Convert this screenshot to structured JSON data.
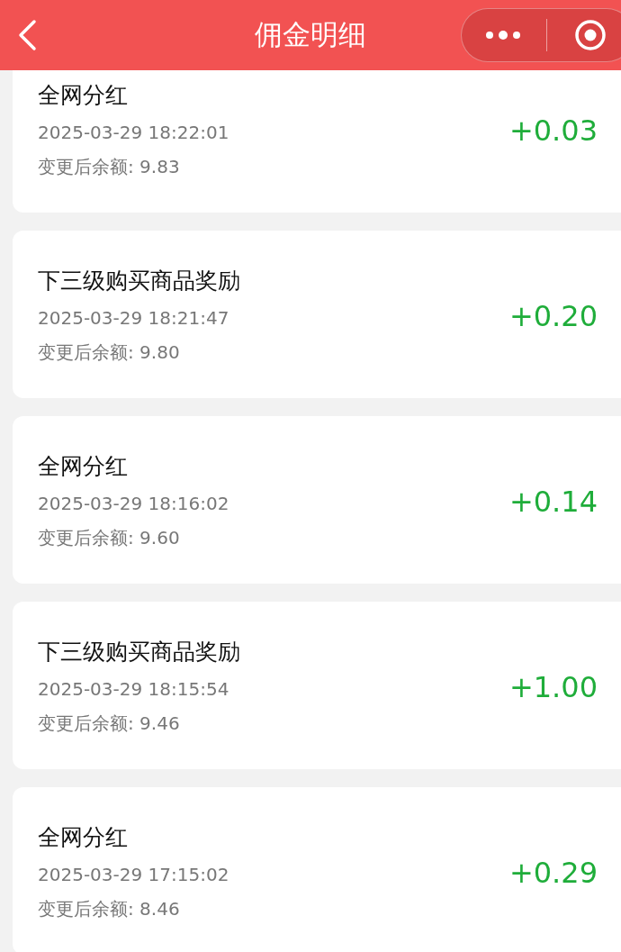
{
  "header": {
    "title": "佣金明细"
  },
  "records": [
    {
      "title": "全网分红",
      "time": "2025-03-29 18:22:01",
      "balance": "变更后余额: 9.83",
      "amount": "+0.03"
    },
    {
      "title": "下三级购买商品奖励",
      "time": "2025-03-29 18:21:47",
      "balance": "变更后余额: 9.80",
      "amount": "+0.20"
    },
    {
      "title": "全网分红",
      "time": "2025-03-29 18:16:02",
      "balance": "变更后余额: 9.60",
      "amount": "+0.14"
    },
    {
      "title": "下三级购买商品奖励",
      "time": "2025-03-29 18:15:54",
      "balance": "变更后余额: 9.46",
      "amount": "+1.00"
    },
    {
      "title": "全网分红",
      "time": "2025-03-29 17:15:02",
      "balance": "变更后余额: 8.46",
      "amount": "+0.29"
    }
  ]
}
